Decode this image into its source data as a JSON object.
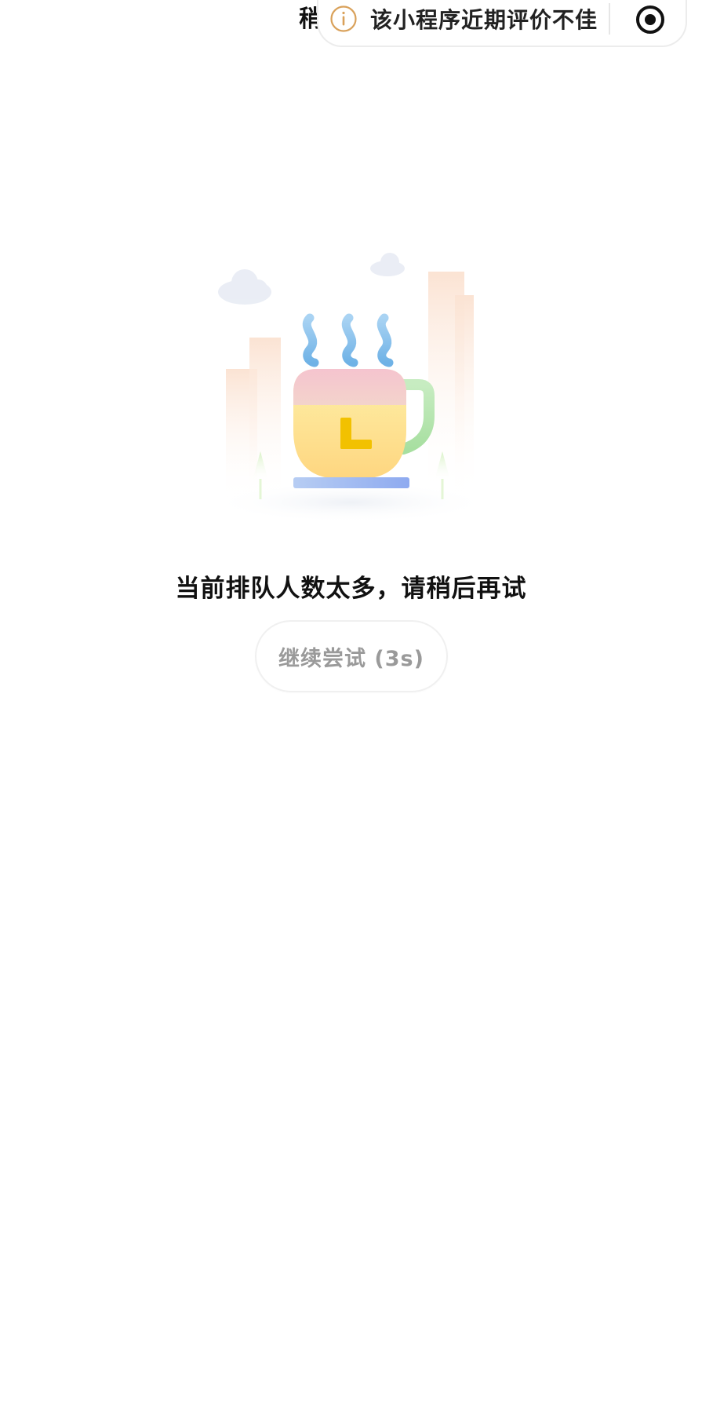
{
  "header": {
    "page_title": "稍后再试",
    "capsule": {
      "warning_text": "该小程序近期评价不佳",
      "warning_icon": "info-circle-icon",
      "close_icon": "target-circle-icon"
    }
  },
  "main": {
    "illustration": "coffee-cup-illustration",
    "message": "当前排队人数太多，请稍后再试",
    "retry_button_label": "继续尝试 (3s)"
  },
  "colors": {
    "warning_accent": "#d9a15a",
    "retry_text": "#9a9a9a",
    "cup_body": "#fde88f",
    "cup_top": "#f1c7cf",
    "steam": "#7fbce8",
    "handle": "#b8e6b0",
    "saucer": "#8fb0ef",
    "clock_hand": "#f2c100"
  }
}
